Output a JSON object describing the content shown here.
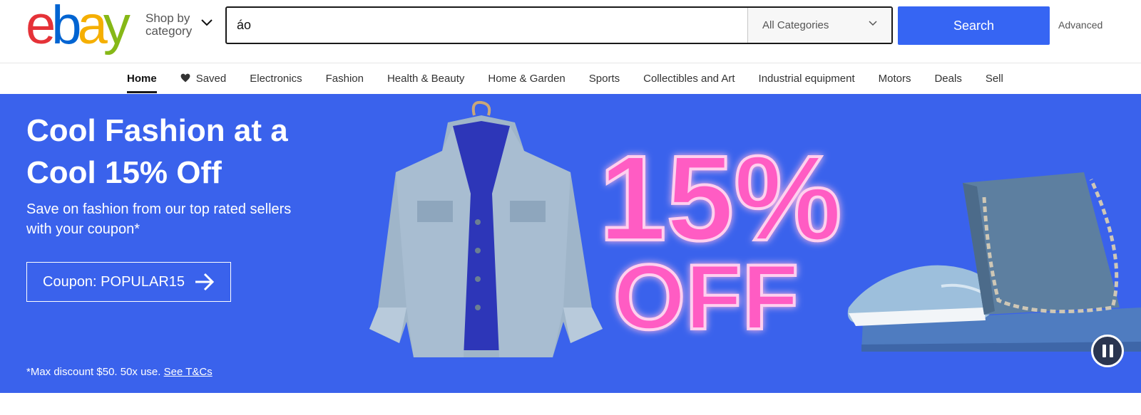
{
  "logo": {
    "letters": [
      "e",
      "b",
      "a",
      "y"
    ],
    "colors": [
      "#e53238",
      "#0064d2",
      "#f5af02",
      "#86b817"
    ]
  },
  "header": {
    "shop_by_label": "Shop by category",
    "search_value": "áo",
    "category_selected": "All Categories",
    "search_button_label": "Search",
    "advanced_label": "Advanced"
  },
  "nav": {
    "items": [
      {
        "label": "Home",
        "active": true
      },
      {
        "label": "Saved"
      },
      {
        "label": "Electronics"
      },
      {
        "label": "Fashion"
      },
      {
        "label": "Health & Beauty"
      },
      {
        "label": "Home & Garden"
      },
      {
        "label": "Sports"
      },
      {
        "label": "Collectibles and Art"
      },
      {
        "label": "Industrial equipment"
      },
      {
        "label": "Motors"
      },
      {
        "label": "Deals"
      },
      {
        "label": "Sell"
      }
    ]
  },
  "banner": {
    "title": "Cool Fashion at a Cool 15% Off",
    "subtitle": "Save on fashion from our top rated sellers with your coupon*",
    "coupon_label": "Coupon: POPULAR15",
    "fine_print": "*Max discount $50. 50x use.",
    "terms_link": "See T&Cs",
    "graphic_text_line1": "15%",
    "graphic_text_line2": "OFF",
    "background_color": "#3a62ec",
    "accent_color": "#ff4fb8"
  },
  "theme": {
    "primary_button": "#3665f3"
  }
}
